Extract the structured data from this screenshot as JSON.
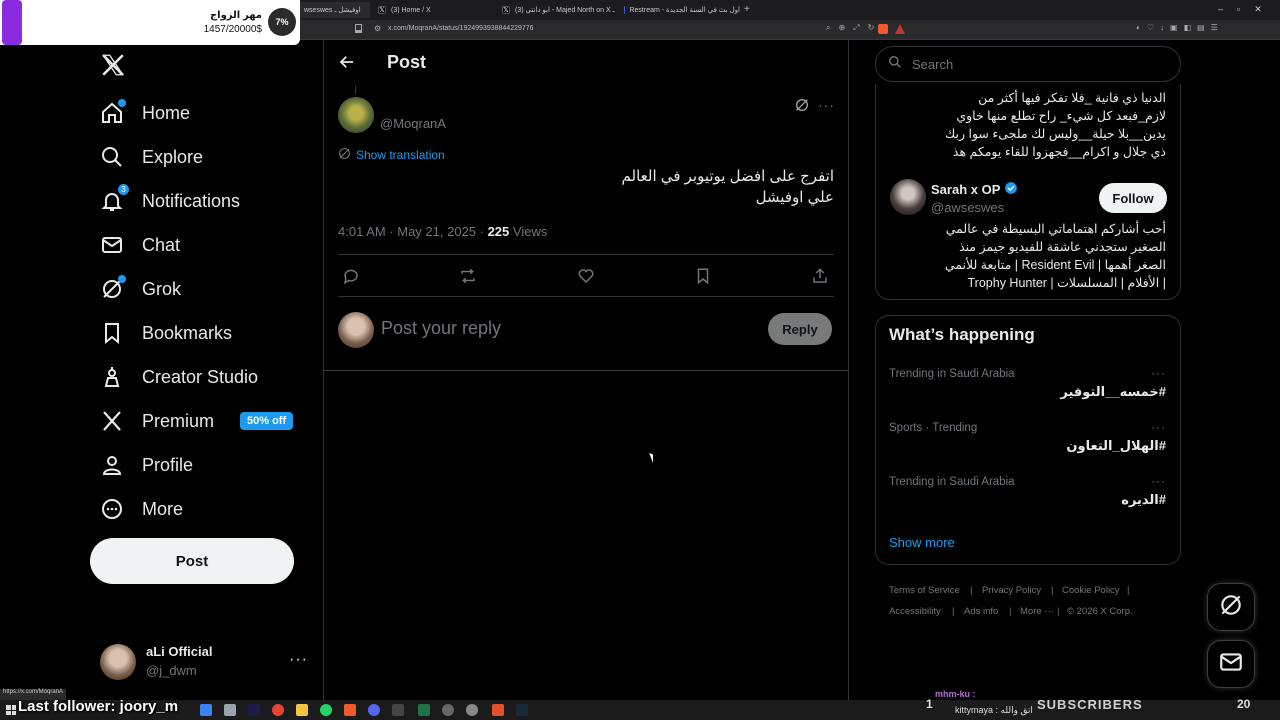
{
  "browser": {
    "tabs": [
      {
        "title": "wseswes اوفيشل ـ"
      },
      {
        "title": "(3) Home / X"
      },
      {
        "title": "(3) ابو دانتي - Majed North on X ـ"
      },
      {
        "title": "Restream - اول بث في السنة الجديدة"
      }
    ],
    "url": "x.com/MoqranA/status/1924993938844229776",
    "status_url": "https://x.com/MoqranA"
  },
  "overlay": {
    "goal_title": "مهر الزواج",
    "goal_count": "1457/20000$",
    "goal_percent": "7%",
    "last_follower": "Last follower: joory_m",
    "subscribers_label": "SUBSCRIBERS",
    "chat_user1": "mhm-ku :",
    "chat_user2": "kittymaya : اتق والله",
    "counter": "20",
    "taskbar_left_num": "1"
  },
  "sidebar": {
    "items": [
      {
        "label": "Home",
        "icon": "home-icon"
      },
      {
        "label": "Explore",
        "icon": "search-icon"
      },
      {
        "label": "Notifications",
        "icon": "bell-icon",
        "badge": "3"
      },
      {
        "label": "Chat",
        "icon": "mail-icon"
      },
      {
        "label": "Grok",
        "icon": "grok-icon"
      },
      {
        "label": "Bookmarks",
        "icon": "bookmark-icon"
      },
      {
        "label": "Creator Studio",
        "icon": "creator-studio-icon"
      },
      {
        "label": "Premium",
        "icon": "x-logo-icon",
        "badge": "50% off"
      },
      {
        "label": "Profile",
        "icon": "person-icon"
      },
      {
        "label": "More",
        "icon": "more-circle-icon"
      }
    ],
    "post_button": "Post",
    "account": {
      "name": "aLi Official",
      "handle": "@j_dwm",
      "more": "···"
    }
  },
  "main": {
    "title": "Post",
    "post": {
      "handle": "@MoqranA",
      "show_translation": "Show translation",
      "text_lines": [
        "اتفرج على افضل يوتيوبر في العالم",
        "علي اوفيشل"
      ],
      "time": "4:01 AM · May 21, 2025 · ",
      "views_count": "225",
      "views_label": " Views",
      "more": "···"
    },
    "reply": {
      "placeholder": "Post your reply",
      "button": "Reply"
    }
  },
  "right": {
    "search_placeholder": "Search",
    "bio_top_lines": [
      "الدنيا ذي فانية _فلا تفكر فيها أكثر من",
      "لازم_فبعد كل شيء_ راح تطلع منها خاوي",
      "يدين__بلا حيلة__وليس لك ملجىء سوا ربك",
      "ذي جلال و اكرام__فجهزوا للقاء يومكم هذ"
    ],
    "who_to_follow": {
      "name": "Sarah x OP",
      "handle": "@awseswes",
      "follow_label": "Follow",
      "bio_lines": [
        "أحب أشاركم اهتماماتي البسيطة في عالمي",
        "الصغير ستجدني عاشقة للفيديو جيمز منذ",
        "الصغر أهمها | Resident Evil | متابعة للأنمي",
        "| الأفلام | المسلسلات | Trophy Hunter"
      ]
    },
    "trends_title": "What’s happening",
    "trends": [
      {
        "context": "Trending in Saudi Arabia",
        "tag": "#خمسه__التوفير",
        "more": "···"
      },
      {
        "context": "Sports · Trending",
        "tag": "#الهلال_التعاون",
        "more": "···"
      },
      {
        "context": "Trending in Saudi Arabia",
        "tag": "#الديره",
        "more": "···"
      }
    ],
    "show_more": "Show more",
    "footer": {
      "terms": "Terms of Service",
      "sep": "|",
      "privacy": "Privacy Policy",
      "cookie": "Cookie Policy",
      "accessibility": "Accessibility",
      "ads": "Ads info",
      "more": "More ···",
      "copyright": "© 2026 X Corp."
    }
  },
  "colors": {
    "accent": "#1d9bf0",
    "background": "#000000",
    "text": "#e7e9ea",
    "muted": "#71767b",
    "border": "#2f3336"
  }
}
